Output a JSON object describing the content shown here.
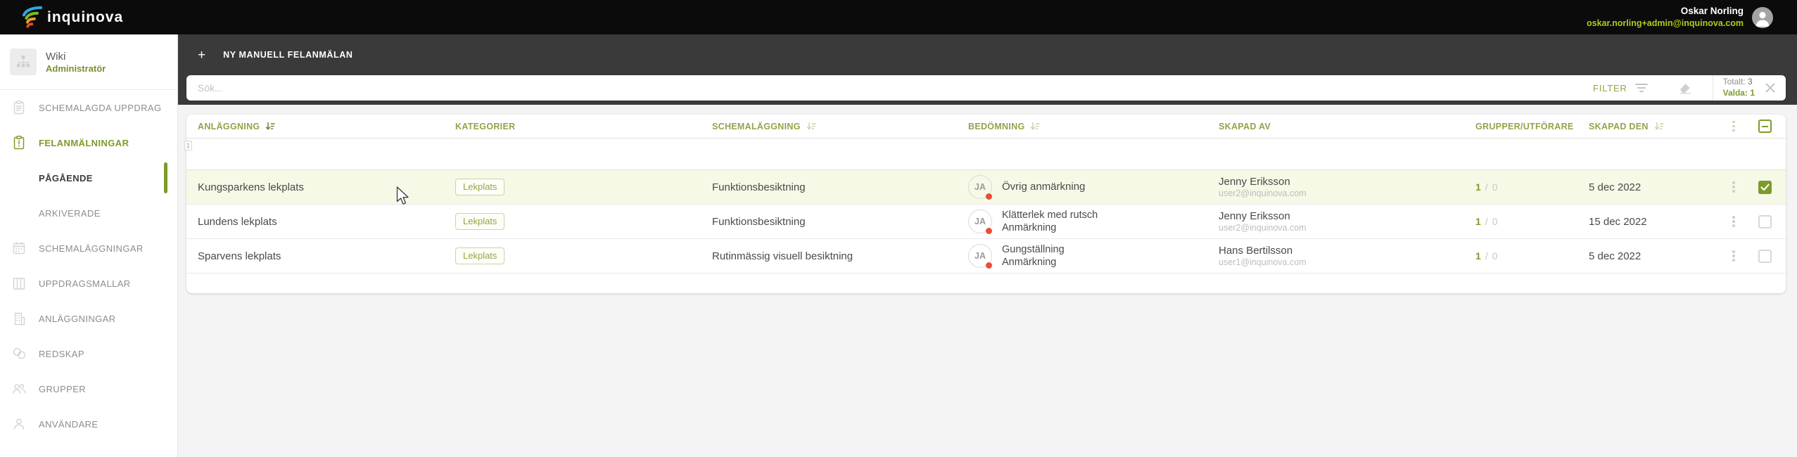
{
  "topbar": {
    "logo_text": "inquinova",
    "user_name": "Oskar Norling",
    "user_email": "oskar.norling+admin@inquinova.com"
  },
  "sidebar": {
    "profile": {
      "title": "Wiki",
      "subtitle": "Administratör"
    },
    "items": [
      {
        "label": "SCHEMALAGDA UPPDRAG"
      },
      {
        "label": "FELANMÄLNINGAR"
      },
      {
        "label": "PÅGÅENDE"
      },
      {
        "label": "ARKIVERADE"
      },
      {
        "label": "SCHEMALÄGGNINGAR"
      },
      {
        "label": "UPPDRAGSMALLAR"
      },
      {
        "label": "ANLÄGGNINGAR"
      },
      {
        "label": "REDSKAP"
      },
      {
        "label": "GRUPPER"
      },
      {
        "label": "ANVÄNDARE"
      }
    ]
  },
  "toolbar": {
    "plus": "+",
    "new_button_label": "NY MANUELL FELANMÄLAN"
  },
  "filterbar": {
    "search_placeholder": "Sök...",
    "filter_label": "FILTER",
    "totals": {
      "total_label": "Totalt:",
      "total_value": "3",
      "selected_label": "Valda:",
      "selected_value": "1"
    }
  },
  "table": {
    "columns": [
      "ANLÄGGNING",
      "KATEGORIER",
      "SCHEMALÄGGNING",
      "BEDÖMNING",
      "SKAPAD AV",
      "GRUPPER/UTFÖRARE",
      "SKAPAD DEN"
    ],
    "row_index_badge": "1",
    "counts_separator": "/",
    "rows": [
      {
        "facility": "Kungsparkens lekplats",
        "category": "Lekplats",
        "schedule": "Funktionsbesiktning",
        "assessment_initials": "JA",
        "assessment_line1": "Övrig anmärkning",
        "created_by_name": "Jenny Eriksson",
        "created_by_email": "user2@inquinova.com",
        "groups_count": "1",
        "performers_count": "0",
        "created_date": "5 dec 2022"
      },
      {
        "facility": "Lundens lekplats",
        "category": "Lekplats",
        "schedule": "Funktionsbesiktning",
        "assessment_initials": "JA",
        "assessment_line1": "Klätterlek med rutsch",
        "assessment_line2": "Anmärkning",
        "created_by_name": "Jenny Eriksson",
        "created_by_email": "user2@inquinova.com",
        "groups_count": "1",
        "performers_count": "0",
        "created_date": "15 dec 2022"
      },
      {
        "facility": "Sparvens lekplats",
        "category": "Lekplats",
        "schedule": "Rutinmässig visuell besiktning",
        "assessment_initials": "JA",
        "assessment_line1": "Gungställning",
        "assessment_line2": "Anmärkning",
        "created_by_name": "Hans Bertilsson",
        "created_by_email": "user1@inquinova.com",
        "groups_count": "1",
        "performers_count": "0",
        "created_date": "5 dec 2022"
      }
    ]
  },
  "colors": {
    "accent_green": "#7d9b2a",
    "email_yellow_green": "#b5c918",
    "row_highlight": "#f6f9e6",
    "alert_red": "#ee4b3b",
    "topbar_black": "#0b0b0b",
    "band_dark": "#3a3a3a"
  }
}
